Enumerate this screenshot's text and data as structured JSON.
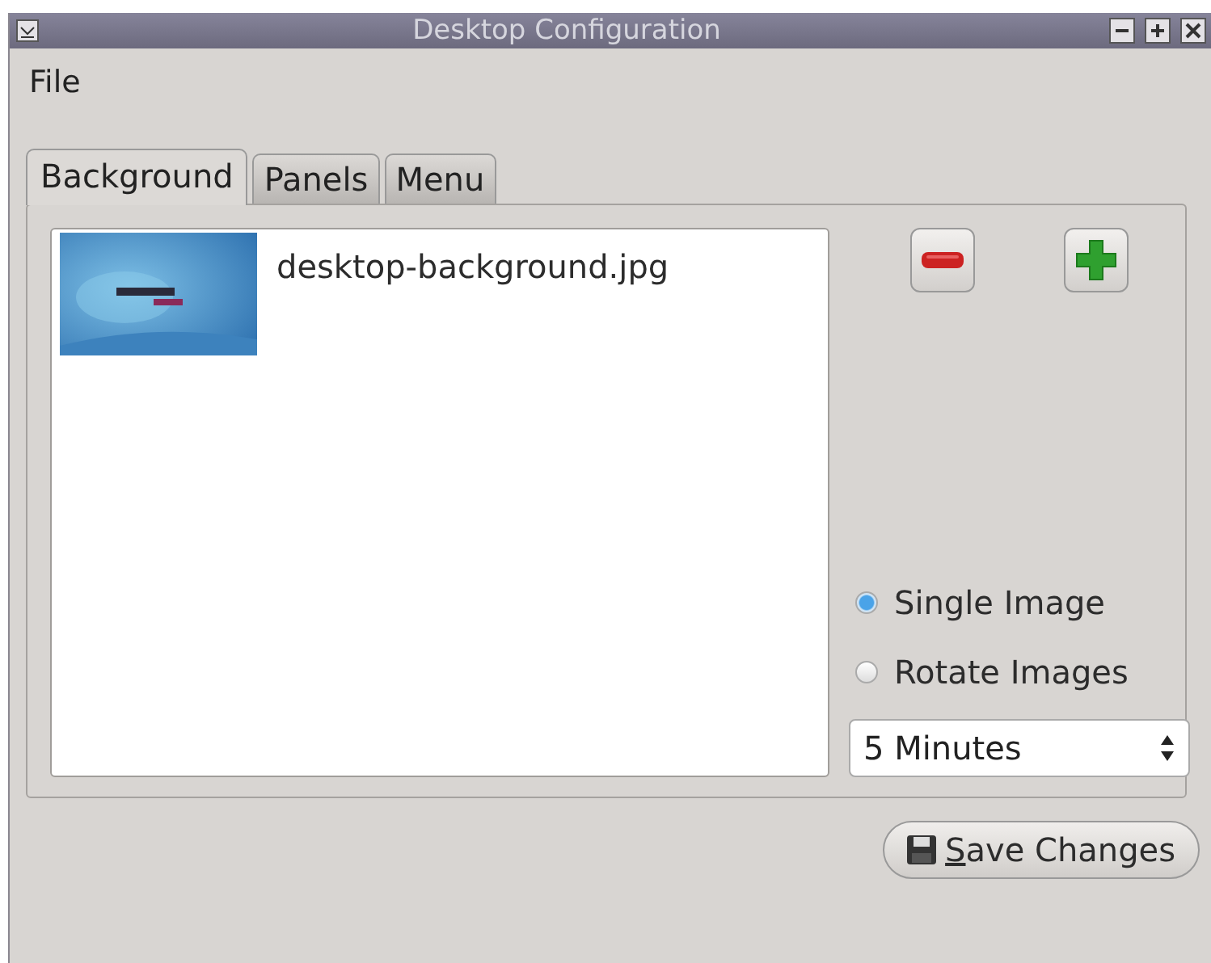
{
  "window": {
    "title": "Desktop Configuration"
  },
  "menu": [
    "File"
  ],
  "tabs": [
    {
      "label": "Background",
      "selected": true
    },
    {
      "label": "Panels",
      "selected": false
    },
    {
      "label": "Menu",
      "selected": false
    }
  ],
  "backgrounds": [
    {
      "kind": "picture",
      "file": "desktop-background.jpg"
    }
  ],
  "mode_options": [
    {
      "label": "Single Image",
      "selected": true
    },
    {
      "label": "Rotate Images",
      "selected": false
    }
  ],
  "interval": {
    "value": "5  Minutes"
  },
  "save_button": {
    "label": "Save Changes",
    "mnemonic_first_letter": true
  }
}
